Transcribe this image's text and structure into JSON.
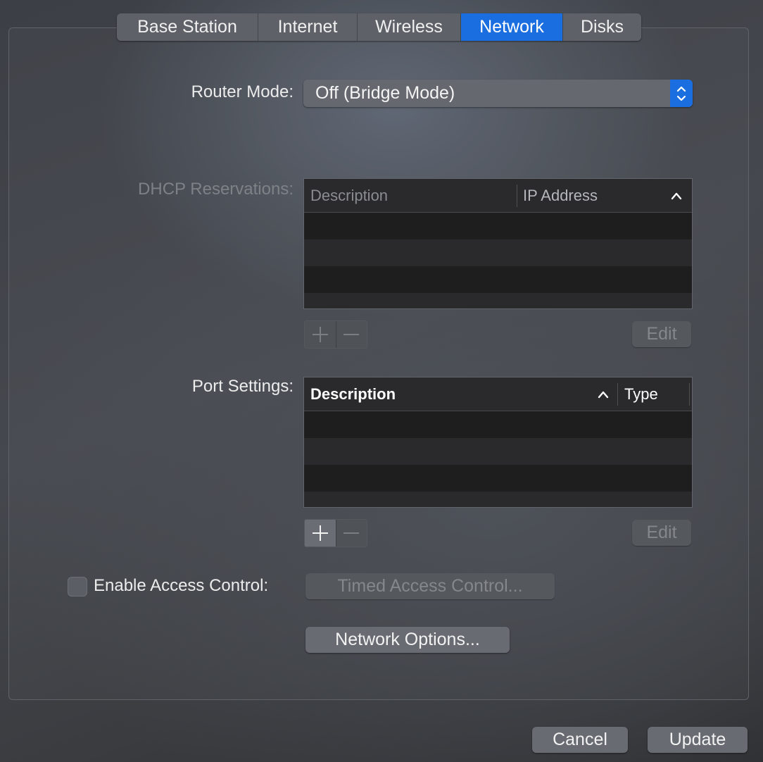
{
  "tabs": [
    {
      "label": "Base Station",
      "active": false
    },
    {
      "label": "Internet",
      "active": false
    },
    {
      "label": "Wireless",
      "active": false
    },
    {
      "label": "Network",
      "active": true
    },
    {
      "label": "Disks",
      "active": false
    }
  ],
  "router_mode": {
    "label": "Router Mode:",
    "value": "Off (Bridge Mode)"
  },
  "dhcp": {
    "label": "DHCP Reservations:",
    "columns": [
      "Description",
      "IP Address"
    ],
    "sort_column": "IP Address",
    "rows": [],
    "add_enabled": false,
    "remove_enabled": false,
    "edit_label": "Edit",
    "edit_enabled": false
  },
  "ports": {
    "label": "Port Settings:",
    "columns": [
      "Description",
      "Type"
    ],
    "sort_column": "Description",
    "rows": [],
    "add_enabled": true,
    "remove_enabled": false,
    "edit_label": "Edit",
    "edit_enabled": false
  },
  "access_control": {
    "checkbox_label": "Enable Access Control:",
    "checked": false,
    "timed_button_label": "Timed Access Control...",
    "timed_enabled": false
  },
  "network_options_label": "Network Options...",
  "footer": {
    "cancel_label": "Cancel",
    "update_label": "Update"
  },
  "colors": {
    "accent": "#1a6ee0",
    "panel_bg": "#45484e",
    "table_row_dark": "#1e1e1e",
    "table_row_light": "#2a2a2c"
  }
}
